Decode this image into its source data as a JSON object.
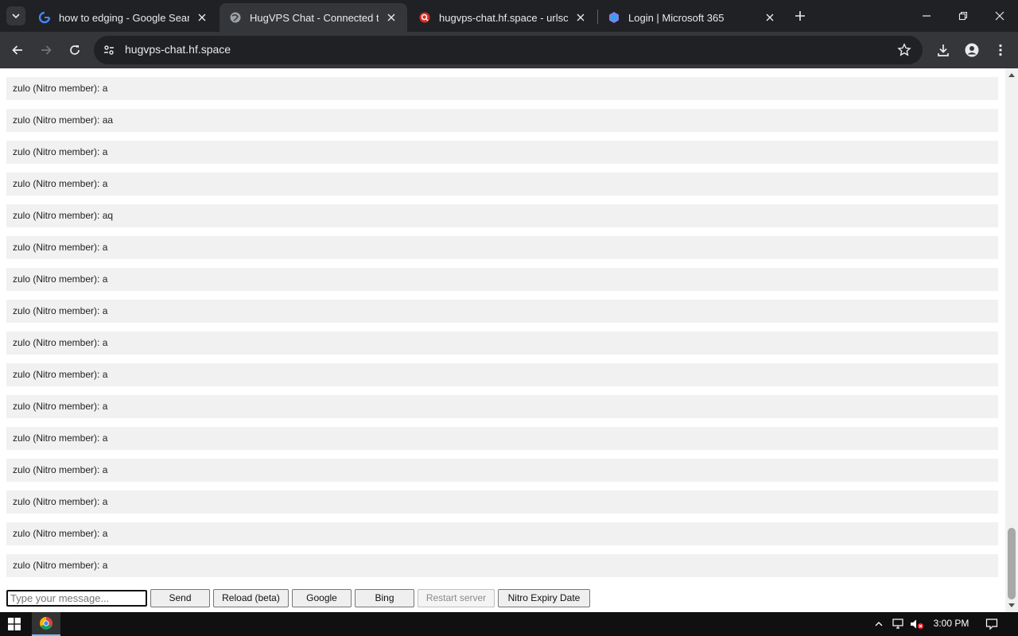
{
  "browser": {
    "tabs": [
      {
        "title": "how to edging - Google Search",
        "favicon": "google-icon",
        "active": false
      },
      {
        "title": "HugVPS Chat - Connected to se",
        "favicon": "globe-icon",
        "active": true
      },
      {
        "title": "hugvps-chat.hf.space - urlscan.",
        "favicon": "urlscan-icon",
        "active": false
      },
      {
        "title": "Login | Microsoft 365",
        "favicon": "microsoft365-icon",
        "active": false
      }
    ],
    "url": "hugvps-chat.hf.space",
    "accent": "#35363a"
  },
  "chat": {
    "messages": [
      "zulo (Nitro member): a",
      "zulo (Nitro member): aa",
      "zulo (Nitro member): a",
      "zulo (Nitro member): a",
      "zulo (Nitro member): aq",
      "zulo (Nitro member): a",
      "zulo (Nitro member): a",
      "zulo (Nitro member): a",
      "zulo (Nitro member): a",
      "zulo (Nitro member): a",
      "zulo (Nitro member): a",
      "zulo (Nitro member): a",
      "zulo (Nitro member): a",
      "zulo (Nitro member): a",
      "zulo (Nitro member): a",
      "zulo (Nitro member): a"
    ],
    "input_placeholder": "Type your message...",
    "buttons": {
      "send": "Send",
      "reload": "Reload (beta)",
      "google": "Google",
      "bing": "Bing",
      "restart": "Restart server",
      "nitro": "Nitro Expiry Date"
    }
  },
  "taskbar": {
    "clock": "3:00 PM"
  }
}
